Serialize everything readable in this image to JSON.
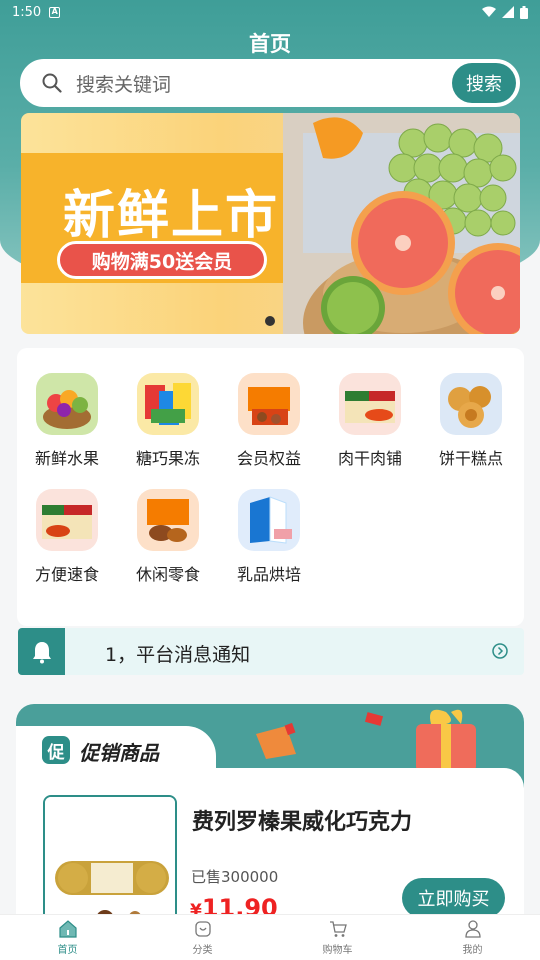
{
  "status_bar": {
    "time": "1:50",
    "badge": "A"
  },
  "header": {
    "title": "首页"
  },
  "search": {
    "placeholder": "搜索关键词",
    "button_label": "搜索"
  },
  "banner": {
    "headline": "新鲜上市",
    "subline": "购物满50送会员"
  },
  "categories": [
    {
      "label": "新鲜水果",
      "icon": "fruit-basket-icon"
    },
    {
      "label": "糖巧果冻",
      "icon": "candy-icon"
    },
    {
      "label": "会员权益",
      "icon": "member-gift-icon"
    },
    {
      "label": "肉干肉铺",
      "icon": "meat-snack-icon"
    },
    {
      "label": "饼干糕点",
      "icon": "mooncake-icon"
    },
    {
      "label": "方便速食",
      "icon": "instant-noodle-icon"
    },
    {
      "label": "休闲零食",
      "icon": "snack-box-icon"
    },
    {
      "label": "乳品烘培",
      "icon": "milk-icon"
    }
  ],
  "notice": {
    "text": "1，平台消息通知"
  },
  "promo": {
    "tab_icon": "促",
    "title": "促销商品",
    "product": {
      "name": "费列罗榛果威化巧克力",
      "sold": "已售300000",
      "currency": "¥",
      "price": "11.90",
      "buy_label": "立即购买"
    }
  },
  "tabbar": [
    {
      "label": "首页",
      "icon": "home-icon",
      "active": true
    },
    {
      "label": "分类",
      "icon": "category-icon",
      "active": false
    },
    {
      "label": "购物车",
      "icon": "cart-icon",
      "active": false
    },
    {
      "label": "我的",
      "icon": "profile-icon",
      "active": false
    }
  ],
  "colors": {
    "primary": "#2d8e88",
    "price": "#ee2222",
    "banner_orange": "#f7b32b",
    "banner_pill": "#e9534a"
  }
}
